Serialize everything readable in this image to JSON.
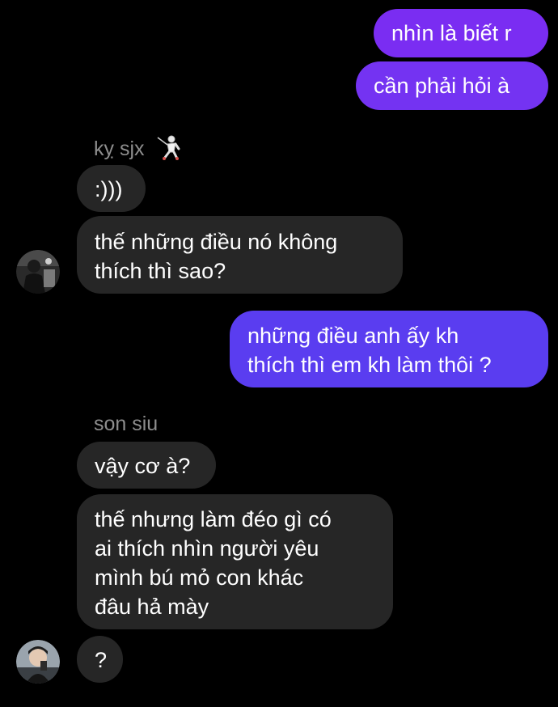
{
  "colors": {
    "background": "#000000",
    "incoming_bubble": "#262626",
    "outgoing_top": "#7a2df2",
    "outgoing_bottom": "#5a3df0",
    "sender_name": "#8e8e8e"
  },
  "messages": {
    "m1": "nhìn là biết r",
    "m2": "cần phải hỏi à",
    "sender1": "kỵ sjx",
    "sender1_emoji": "fencer-icon",
    "m3": ":)))",
    "m4": [
      "thế những điều nó không",
      "thích thì sao?"
    ],
    "m5": [
      "những điều anh ấy kh",
      "thích thì em kh làm thôi ?"
    ],
    "sender2": "son siu",
    "m6": "vậy cơ à?",
    "m7": [
      "thế nhưng làm đéo gì có",
      "ai thích nhìn người yêu",
      "mình bú mỏ con khác",
      "đâu hả mày"
    ],
    "m8": "?"
  }
}
